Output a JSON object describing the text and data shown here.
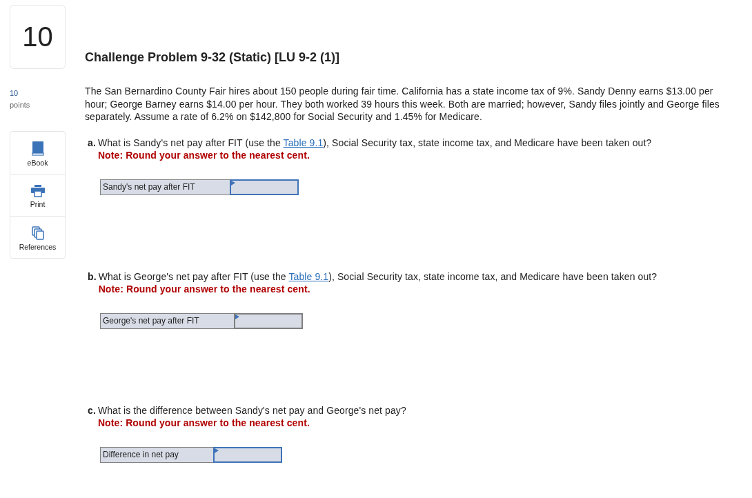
{
  "question_number": "10",
  "points": {
    "value": "10",
    "label": "points"
  },
  "tools": [
    {
      "kind": "ebook",
      "label": "eBook"
    },
    {
      "kind": "print",
      "label": "Print"
    },
    {
      "kind": "references",
      "label": "References"
    }
  ],
  "title": "Challenge Problem 9-32 (Static) [LU 9-2 (1)]",
  "intro": "The San Bernardino County Fair hires about 150 people during fair time. California has a state income tax of 9%. Sandy Denny earns $13.00 per hour; George Barney earns $14.00 per hour. They both worked 39 hours this week. Both are married; however, Sandy files jointly and George files separately. Assume a rate of 6.2% on $142,800 for Social Security and 1.45% for Medicare.",
  "parts": [
    {
      "letter": "a.",
      "question": [
        "What is Sandy's net pay after FIT (use the ",
        "Table 9.1",
        "), Social Security tax, state income tax, and Medicare have been taken out?"
      ],
      "note": "Note: Round your answer to the nearest cent.",
      "answer_label": "Sandy's net pay after FIT",
      "focused": true
    },
    {
      "letter": "b.",
      "question": [
        "What is George's net pay after FIT (use the ",
        "Table 9.1",
        "), Social Security tax, state income tax, and Medicare have been taken out?"
      ],
      "note": "Note: Round your answer to the nearest cent.",
      "answer_label": "George's net pay after FIT",
      "focused": false
    },
    {
      "letter": "c.",
      "question": [
        "What is the difference between Sandy's net pay and George's net pay?"
      ],
      "note": "Note: Round your answer to the nearest cent.",
      "answer_label": "Difference in net pay",
      "focused": true
    }
  ]
}
